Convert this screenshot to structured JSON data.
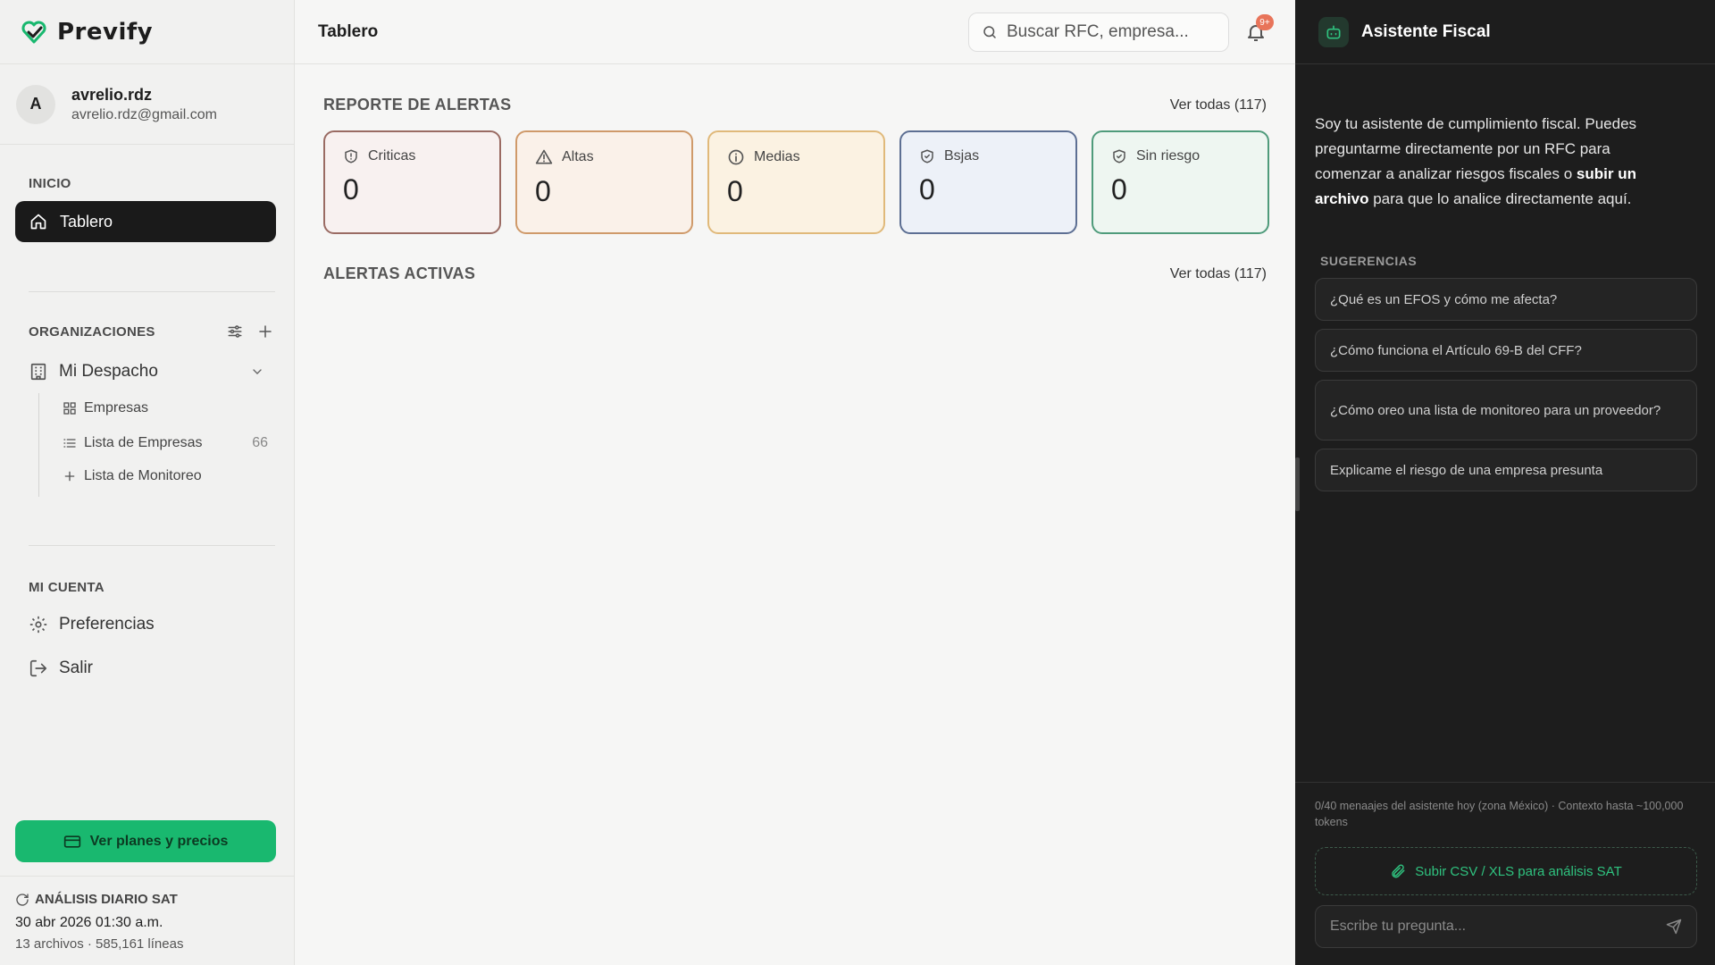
{
  "brand": {
    "name": "Prevify",
    "accent": "#19b86f"
  },
  "user": {
    "initial": "A",
    "name": "avrelio.rdz",
    "email": "avrelio.rdz@gmail.com"
  },
  "sidebar": {
    "inicio_label": "INICIO",
    "tablero_label": "Tablero",
    "orgs_label": "ORGANIZACIONES",
    "org_name": "Mi Despacho",
    "org_items": [
      {
        "label": "Empresas",
        "icon": "grid-icon",
        "count": ""
      },
      {
        "label": "Lista de Empresas",
        "icon": "list-icon",
        "count": "66"
      },
      {
        "label": "Lista de Monitoreo",
        "icon": "plus-icon",
        "count": ""
      }
    ],
    "account_label": "MI CUENTA",
    "preferences_label": "Preferencias",
    "logout_label": "Salir",
    "plans_button": "Ver planes y precios",
    "sat": {
      "title": "ANÁLISIS DIARIO SAT",
      "date": "30 abr 2026 01:30 a.m.",
      "meta": "13 archivos · 585,161 líneas"
    }
  },
  "header": {
    "title": "Tablero",
    "search_placeholder": "Buscar RFC, empresa...",
    "notif_badge": "9+"
  },
  "report": {
    "title": "REPORTE DE ALERTAS",
    "link": "Ver todas (117)",
    "cards": [
      {
        "label": "Criticas",
        "value": "0",
        "icon": "shield-alert-icon",
        "border": "#9a6b63",
        "bg": "#f8f1f0"
      },
      {
        "label": "Altas",
        "value": "0",
        "icon": "warning-icon",
        "border": "#cf9a6a",
        "bg": "#faf1e9"
      },
      {
        "label": "Medias",
        "value": "0",
        "icon": "info-icon",
        "border": "#e0b97a",
        "bg": "#fbf2e2"
      },
      {
        "label": "Bsjas",
        "value": "0",
        "icon": "shield-check-icon",
        "border": "#5d6f93",
        "bg": "#edf1f8"
      },
      {
        "label": "Sin riesgo",
        "value": "0",
        "icon": "shield-ok-icon",
        "border": "#4f9b7b",
        "bg": "#eef6f1"
      }
    ]
  },
  "active": {
    "title": "ALERTAS ACTIVAS",
    "link": "Ver todas (117)"
  },
  "assistant": {
    "title": "Asistente Fiscal",
    "intro_a": "Soy tu asistente de cumplimiento fiscal. Puedes preguntarme directamente por un RFC para comenzar a analizar riesgos fiscales o ",
    "intro_bold": "subir un archivo",
    "intro_b": " para que lo analice directamente aquí.",
    "suggestions_label": "SUGERENCIAS",
    "suggestions": [
      "¿Qué es un EFOS y cómo me afecta?",
      "¿Cómo funciona el Artículo 69-B del CFF?",
      "¿Cómo oreo una lista de monitoreo para un proveedor?",
      "Explicame el riesgo de una empresa presunta"
    ],
    "quota": "0/40 menaajes del asistente hoy (zona México) · Contexto hasta ~100,000 tokens",
    "upload_label": "Subir CSV / XLS para análisis SAT",
    "input_placeholder": "Escribe tu pregunta..."
  }
}
